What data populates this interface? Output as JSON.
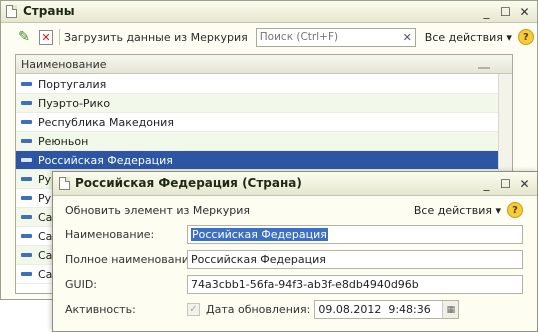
{
  "main_window": {
    "title": "Страны",
    "toolbar": {
      "load_label": "Загрузить данные из Меркурия",
      "search_placeholder": "Поиск (Ctrl+F)",
      "all_actions_label": "Все действия ▾",
      "help_label": "?"
    },
    "list": {
      "column_header": "Наименование",
      "rows": [
        "Португалия",
        "Пуэрто-Рико",
        "Республика Македония",
        "Реюньон",
        "Российская Федерация",
        "Ру",
        "Ру",
        "Са",
        "Са",
        "Са",
        "Са"
      ],
      "selected_index": 4
    }
  },
  "dialog": {
    "title": "Российская Федерация (Страна)",
    "toolbar": {
      "update_label": "Обновить элемент из Меркурия",
      "all_actions_label": "Все действия ▾",
      "help_label": "?"
    },
    "fields": {
      "name_label": "Наименование:",
      "name_value": "Российская Федерация",
      "full_name_label": "Полное наименование:",
      "full_name_value": "Российская Федерация",
      "guid_label": "GUID:",
      "guid_value": "74a3cbb1-56fa-94f3-ab3f-e8db4940d96b",
      "active_label": "Активность:",
      "update_date_label": "Дата обновления:",
      "update_date_value": "09.08.2012  9:48:36"
    }
  },
  "window_controls": {
    "minimize": "_",
    "maximize": "☐",
    "close": "✕"
  }
}
